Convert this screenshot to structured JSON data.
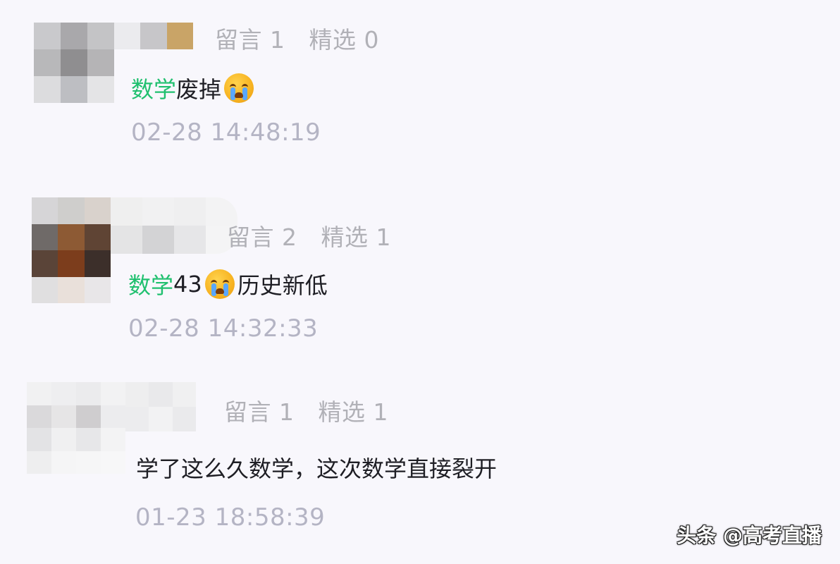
{
  "comments": [
    {
      "stats_comments": "留言 1",
      "stats_featured": "精选 0",
      "tag": "数学",
      "text_before_emoji": " 废掉",
      "text_after_emoji": "",
      "emoji": "crying-face-icon",
      "time": "02-28 14:48:19"
    },
    {
      "stats_comments": "留言 2",
      "stats_featured": "精选 1",
      "tag": "数学",
      "text_before_emoji": "43",
      "text_after_emoji": "历史新低",
      "emoji": "crying-face-icon",
      "time": "02-28 14:32:33"
    },
    {
      "stats_comments": "留言 1",
      "stats_featured": "精选 1",
      "tag": "",
      "text_before_emoji": "学了这么久数学，这次数学直接裂开",
      "text_after_emoji": "",
      "emoji": "",
      "time": "01-23 18:58:39"
    }
  ],
  "watermark": "头条 @高考直播",
  "colors": {
    "background": "#f8f7fc",
    "tag_green": "#20c06f",
    "meta_gray": "#b1b1b7",
    "text_dark": "#1e1e24"
  }
}
